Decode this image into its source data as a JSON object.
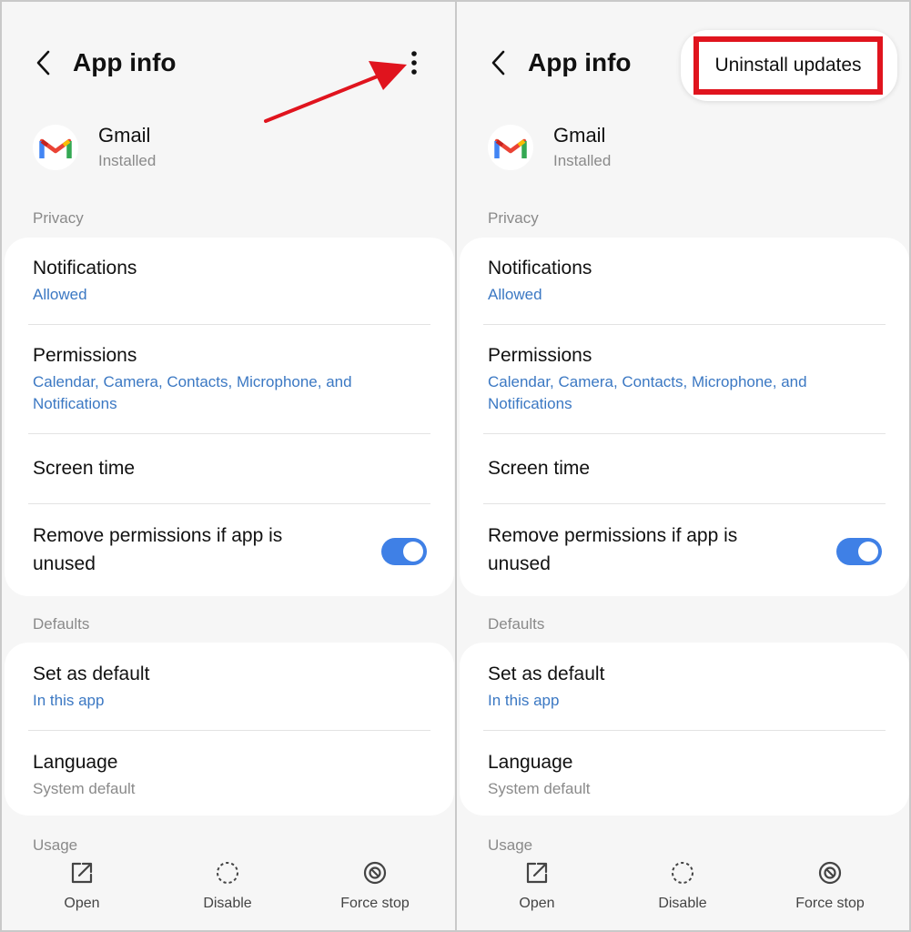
{
  "colors": {
    "accent_link": "#3b78c3",
    "toggle_on": "#3f80e6",
    "annotation_red": "#e0141e",
    "background": "#f6f6f6",
    "card": "#ffffff"
  },
  "panels": [
    {
      "header": {
        "title": "App info",
        "back_icon": "chevron-left-icon",
        "menu_icon": "more-vertical-icon"
      },
      "app": {
        "name": "Gmail",
        "status": "Installed",
        "icon": "gmail-icon"
      },
      "privacy": {
        "label": "Privacy",
        "notifications": {
          "title": "Notifications",
          "value": "Allowed"
        },
        "permissions": {
          "title": "Permissions",
          "value_line1": "Calendar, Camera, Contacts, Microphone, and",
          "value_line2": "Notifications"
        },
        "screen_time": {
          "title": "Screen time"
        },
        "remove_permissions": {
          "title_line1": "Remove permissions if app is",
          "title_line2": "unused",
          "enabled": true
        }
      },
      "defaults": {
        "label": "Defaults",
        "set_as_default": {
          "title": "Set as default",
          "value": "In this app"
        },
        "language": {
          "title": "Language",
          "value": "System default"
        }
      },
      "usage": {
        "label": "Usage"
      },
      "actions": [
        {
          "label": "Open",
          "icon": "open-external-icon"
        },
        {
          "label": "Disable",
          "icon": "disable-dashed-circle-icon"
        },
        {
          "label": "Force stop",
          "icon": "force-stop-icon"
        }
      ],
      "annotation": "red-arrow-pointing-to-menu"
    },
    {
      "header": {
        "title": "App info",
        "back_icon": "chevron-left-icon"
      },
      "overflow_menu": {
        "items": [
          "Uninstall updates"
        ],
        "highlighted": "Uninstall updates"
      },
      "app": {
        "name": "Gmail",
        "status": "Installed",
        "icon": "gmail-icon"
      },
      "privacy": {
        "label": "Privacy",
        "notifications": {
          "title": "Notifications",
          "value": "Allowed"
        },
        "permissions": {
          "title": "Permissions",
          "value_line1": "Calendar, Camera, Contacts, Microphone, and",
          "value_line2": "Notifications"
        },
        "screen_time": {
          "title": "Screen time"
        },
        "remove_permissions": {
          "title_line1": "Remove permissions if app is",
          "title_line2": "unused",
          "enabled": true
        }
      },
      "defaults": {
        "label": "Defaults",
        "set_as_default": {
          "title": "Set as default",
          "value": "In this app"
        },
        "language": {
          "title": "Language",
          "value": "System default"
        }
      },
      "usage": {
        "label": "Usage"
      },
      "actions": [
        {
          "label": "Open",
          "icon": "open-external-icon"
        },
        {
          "label": "Disable",
          "icon": "disable-dashed-circle-icon"
        },
        {
          "label": "Force stop",
          "icon": "force-stop-icon"
        }
      ]
    }
  ]
}
